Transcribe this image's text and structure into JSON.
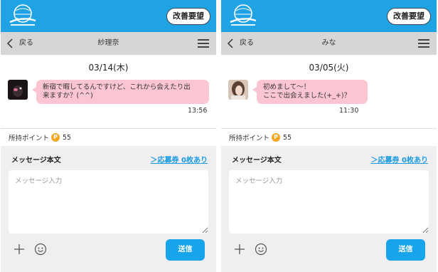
{
  "panels": [
    {
      "header": {
        "logo_alt": "happy-mail-logo",
        "request_button": "改善要望"
      },
      "nav": {
        "back_label": "戻る",
        "title": "紗理奈"
      },
      "chat": {
        "date": "03/14(木)",
        "message_lines": [
          "新宿で暇してるんですけど、これから会えたり出",
          "来ますか？(^^)"
        ],
        "time": "13:56"
      },
      "points": {
        "label": "所持ポイント",
        "coin_symbol": "P",
        "value": "55"
      },
      "compose": {
        "label": "メッセージ本文",
        "ticket_link": "＞応募券 0枚あり",
        "placeholder": "メッセージ入力",
        "send_label": "送信"
      }
    },
    {
      "header": {
        "logo_alt": "happy-mail-logo",
        "request_button": "改善要望"
      },
      "nav": {
        "back_label": "戻る",
        "title": "みな"
      },
      "chat": {
        "date": "03/05(火)",
        "message_lines": [
          "初めまして〜！",
          "ここで出会えました(+_+)？"
        ],
        "time": "11:30"
      },
      "points": {
        "label": "所持ポイント",
        "coin_symbol": "P",
        "value": "55"
      },
      "compose": {
        "label": "メッセージ本文",
        "ticket_link": "＞応募券 0枚あり",
        "placeholder": "メッセージ入力",
        "send_label": "送信"
      }
    }
  ],
  "colors": {
    "header_bg": "#1fa3e4",
    "nav_bg": "#d6d6d6",
    "bubble_bg": "#fbc5d1",
    "compose_bg": "#f0eef0",
    "link": "#1a9be0",
    "send_bg": "#17a4ea",
    "coin": "#f5a623"
  },
  "icons": {
    "back": "chevron-left-icon",
    "menu": "hamburger-menu-icon",
    "plus": "plus-icon",
    "emoji": "smile-icon"
  }
}
